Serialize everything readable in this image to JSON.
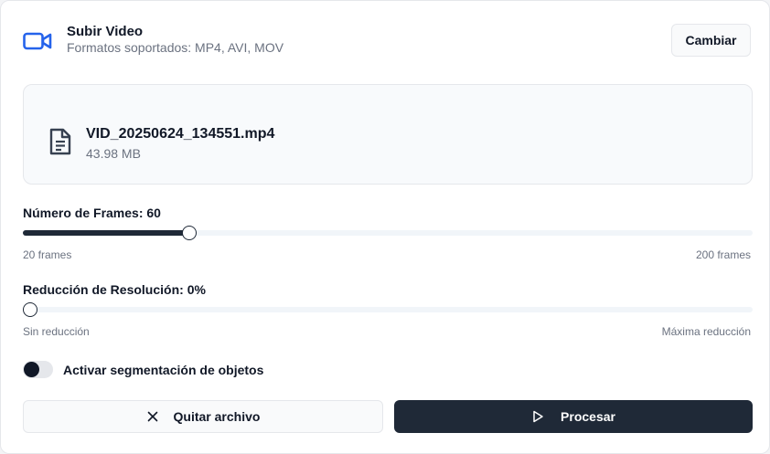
{
  "header": {
    "icon": "video-camera-icon",
    "title": "Subir Video",
    "subtitle": "Formatos soportados: MP4, AVI, MOV",
    "change_button": "Cambiar"
  },
  "file": {
    "icon": "document-icon",
    "name": "VID_20250624_134551.mp4",
    "size": "43.98 MB"
  },
  "frames_slider": {
    "label": "Número de Frames: 60",
    "value": 60,
    "min": 20,
    "max": 200,
    "min_label": "20 frames",
    "max_label": "200 frames"
  },
  "resolution_slider": {
    "label": "Reducción de Resolución: 0%",
    "value_percent": 0,
    "min_label": "Sin reducción",
    "max_label": "Máxima reducción"
  },
  "segmentation_toggle": {
    "label": "Activar segmentación de objetos",
    "enabled": false
  },
  "actions": {
    "remove_label": "Quitar archivo",
    "remove_icon": "close-icon",
    "process_label": "Procesar",
    "process_icon": "play-icon"
  },
  "colors": {
    "accent": "#2563eb",
    "dark": "#1f2937"
  }
}
